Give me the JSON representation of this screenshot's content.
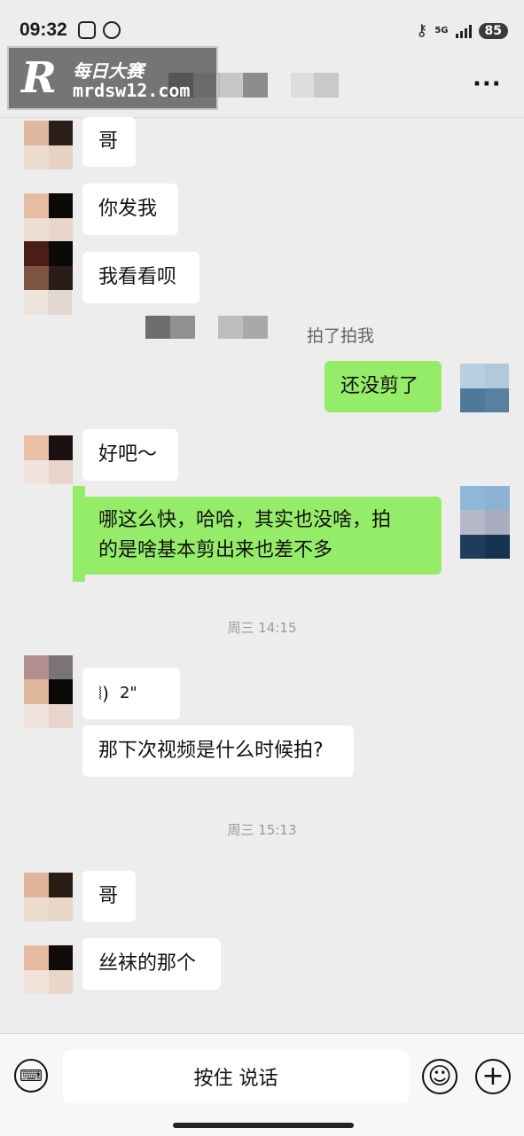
{
  "status_bar": {
    "time": "09:32",
    "network": "5G",
    "battery": "85"
  },
  "watermark": {
    "logo_letter": "R",
    "brand_cn": "每日大赛",
    "url": "mrdsw12.com"
  },
  "header": {
    "more_label": "···"
  },
  "messages": {
    "m1": "哥",
    "m2": "你发我",
    "m3": "我看看呗",
    "system_pat": "拍了拍我",
    "m4": "还没剪了",
    "m5": "好吧～",
    "m6_line1": "哪这么快，哈哈，其实也没啥，拍",
    "m6_line2": "的是啥基本剪出来也差不多",
    "ts1": "周三 14:15",
    "voice_duration": "2\"",
    "m8": "那下次视频是什么时候拍?",
    "ts2": "周三 15:13",
    "m9": "哥",
    "m10": "丝袜的那个"
  },
  "input_bar": {
    "hold_to_talk": "按住 说话"
  },
  "icons": [
    "keyboard-icon",
    "emoji-icon",
    "plus-icon",
    "voice-wave-icon",
    "key-icon",
    "signal-icon",
    "battery-icon"
  ]
}
